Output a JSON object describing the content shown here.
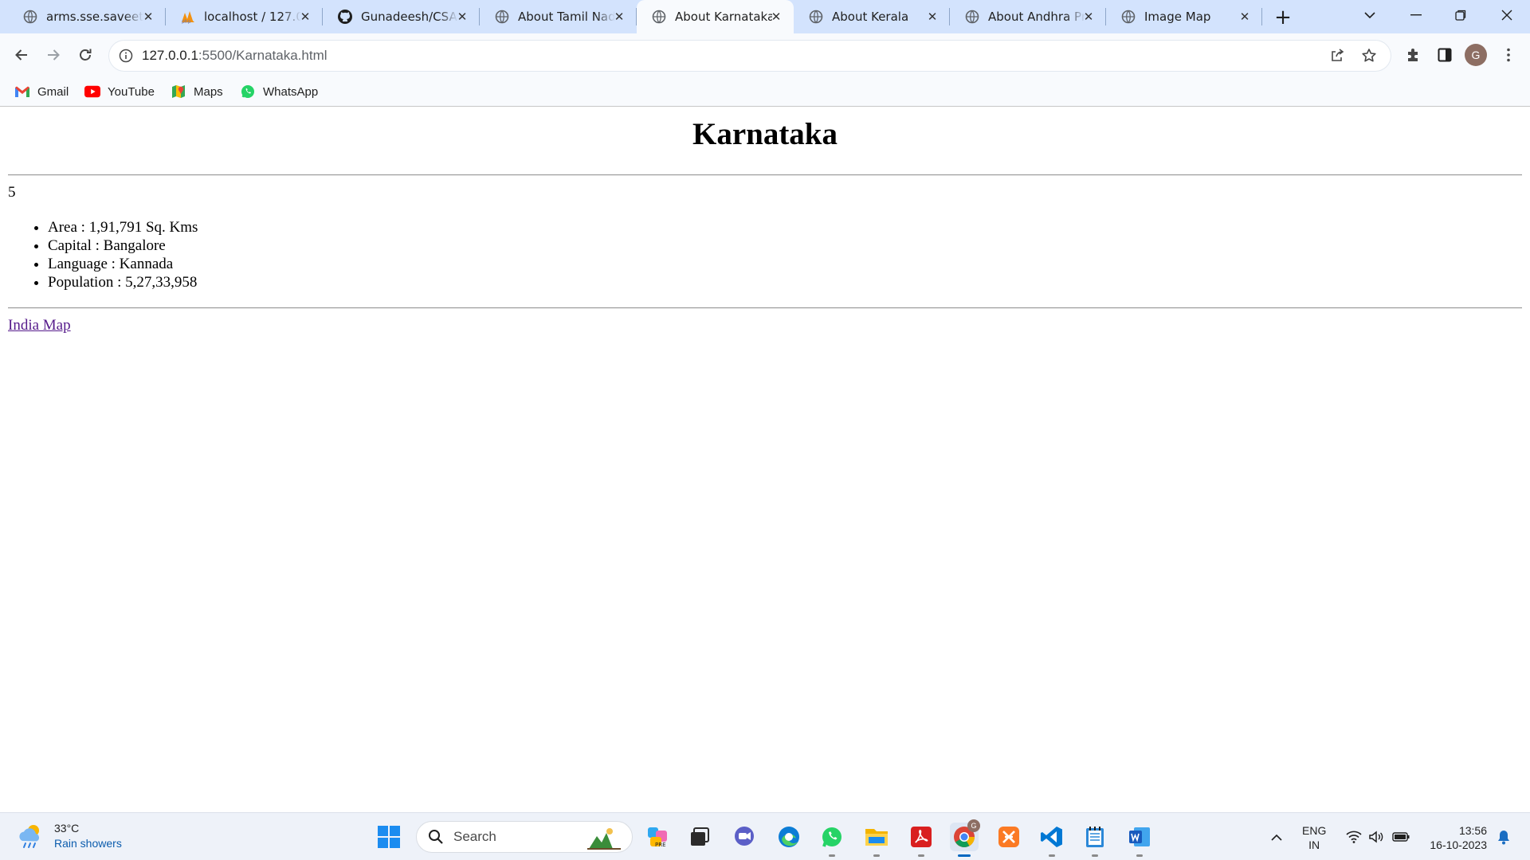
{
  "browser": {
    "tabs": [
      {
        "title": "arms.sse.saveetha",
        "icon": "globe-icon",
        "active": false
      },
      {
        "title": "localhost / 127.0.0.1",
        "icon": "phpmyadmin-icon",
        "active": false
      },
      {
        "title": "Gunadeesh/CSA",
        "icon": "github-icon",
        "active": false
      },
      {
        "title": "About Tamil Nadu",
        "icon": "globe-icon",
        "active": false
      },
      {
        "title": "About Karnataka",
        "icon": "globe-icon",
        "active": true
      },
      {
        "title": "About Kerala",
        "icon": "globe-icon",
        "active": false
      },
      {
        "title": "About Andhra Pradesh",
        "icon": "globe-icon",
        "active": false
      },
      {
        "title": "Image Map",
        "icon": "globe-icon",
        "active": false
      }
    ],
    "url_host": "127.0.0.1",
    "url_path": ":5500/Karnataka.html",
    "profile_initial": "G",
    "bookmarks": [
      {
        "label": "Gmail",
        "icon": "gmail-icon"
      },
      {
        "label": "YouTube",
        "icon": "youtube-icon"
      },
      {
        "label": "Maps",
        "icon": "maps-icon"
      },
      {
        "label": "WhatsApp",
        "icon": "whatsapp-icon"
      }
    ]
  },
  "page": {
    "heading": "Karnataka",
    "stray_text": "5",
    "facts": [
      "Area : 1,91,791 Sq. Kms",
      "Capital : Bangalore",
      "Language : Kannada",
      "Population : 5,27,33,958"
    ],
    "link_text": "India Map"
  },
  "taskbar": {
    "weather_temp": "33°C",
    "weather_condition": "Rain showers",
    "search_placeholder": "Search",
    "language_line1": "ENG",
    "language_line2": "IN",
    "time": "13:56",
    "date": "16-10-2023",
    "chrome_badge": "G"
  },
  "colors": {
    "tabstrip": "#d3e3fd",
    "toolbar": "#f8fafd",
    "visited_link": "#551a8b",
    "taskbar": "#eef2f9"
  }
}
